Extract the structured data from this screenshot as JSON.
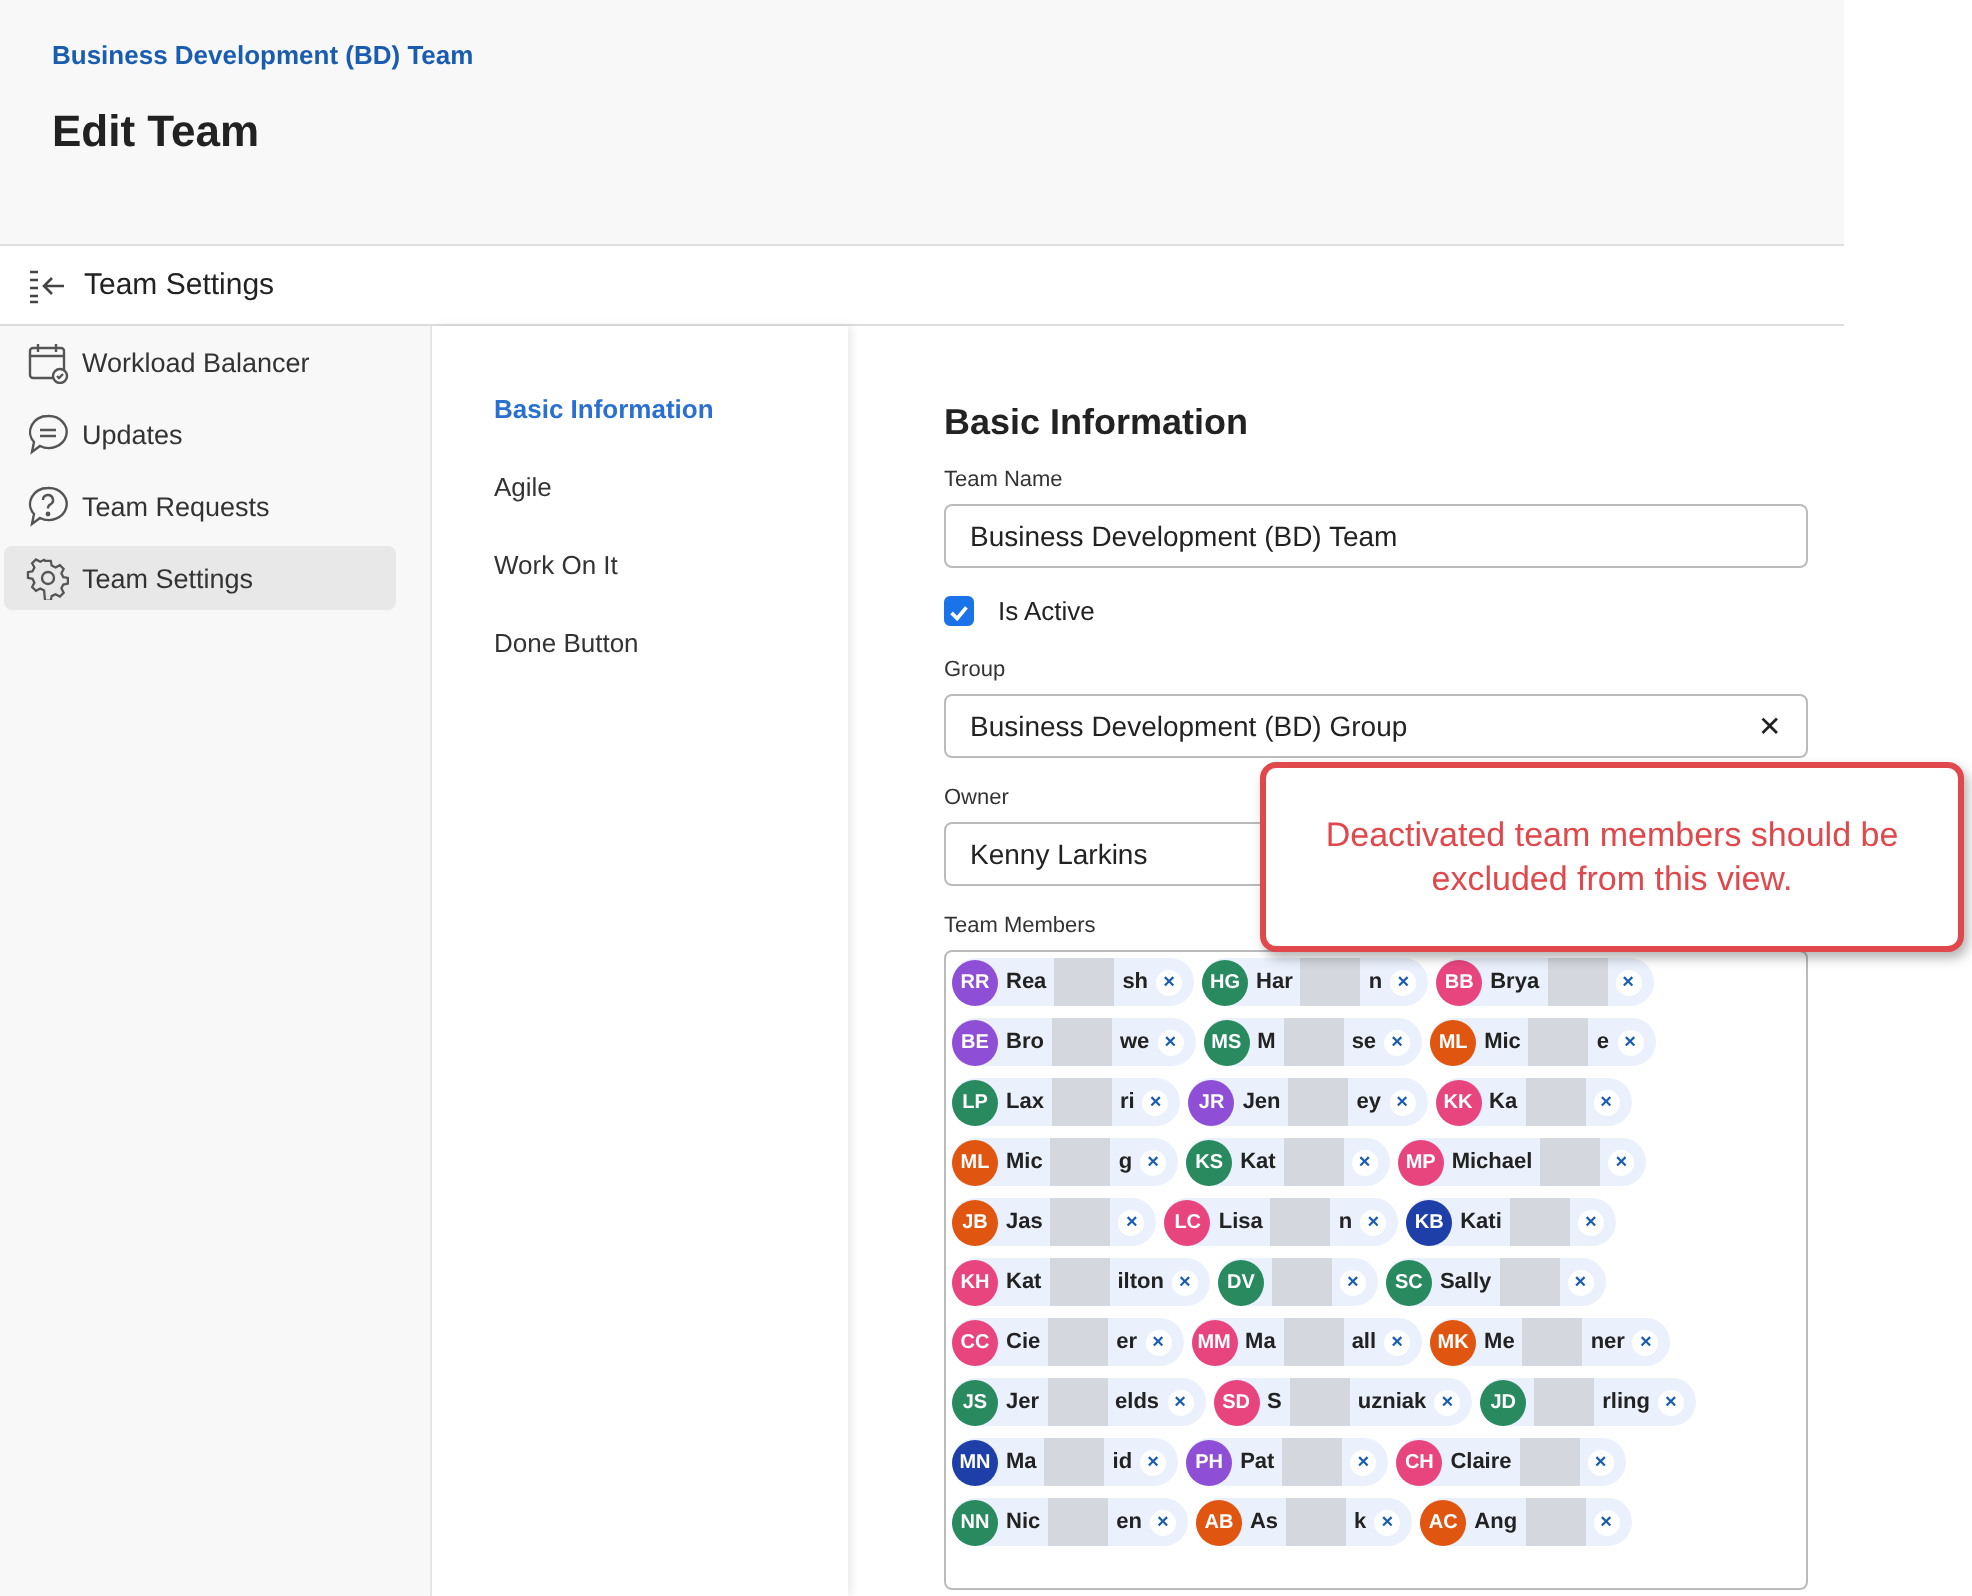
{
  "header": {
    "breadcrumb": "Business Development (BD) Team",
    "title": "Edit Team"
  },
  "settings_bar": {
    "title": "Team Settings"
  },
  "sidebar": {
    "items": [
      {
        "label": "Workload Balancer",
        "selected": false
      },
      {
        "label": "Updates",
        "selected": false
      },
      {
        "label": "Team Requests",
        "selected": false
      },
      {
        "label": "Team Settings",
        "selected": true
      }
    ]
  },
  "section_nav": {
    "items": [
      {
        "label": "Basic Information",
        "selected": true
      },
      {
        "label": "Agile",
        "selected": false
      },
      {
        "label": "Work On It",
        "selected": false
      },
      {
        "label": "Done Button",
        "selected": false
      }
    ]
  },
  "form": {
    "heading": "Basic Information",
    "team_name": {
      "label": "Team Name",
      "value": "Business Development (BD) Team"
    },
    "is_active": {
      "label": "Is Active",
      "checked": true
    },
    "group": {
      "label": "Group",
      "value": "Business Development (BD) Group",
      "clear": "✕"
    },
    "owner": {
      "label": "Owner",
      "value": "Kenny Larkins"
    },
    "team_members": {
      "label": "Team Members",
      "remove": "×",
      "members": [
        {
          "initials": "RR",
          "color": "#8e4fd6",
          "start": "Rea",
          "end": "sh"
        },
        {
          "initials": "HG",
          "color": "#2a8a5f",
          "start": "Har",
          "end": "n"
        },
        {
          "initials": "BB",
          "color": "#e8457e",
          "start": "Brya"
        },
        {
          "initials": "BE",
          "color": "#8e4fd6",
          "start": "Bro",
          "end": "we"
        },
        {
          "initials": "MS",
          "color": "#2a8a5f",
          "start": "M",
          "end": "se"
        },
        {
          "initials": "ML",
          "color": "#e0550f",
          "start": "Mic",
          "end": "e"
        },
        {
          "initials": "LP",
          "color": "#2a8a5f",
          "start": "Lax",
          "end": "ri"
        },
        {
          "initials": "JR",
          "color": "#8e4fd6",
          "start": "Jen",
          "end": "ey"
        },
        {
          "initials": "KK",
          "color": "#e8457e",
          "start": "Ka"
        },
        {
          "initials": "ML",
          "color": "#e0550f",
          "start": "Mic",
          "end": "g"
        },
        {
          "initials": "KS",
          "color": "#2a8a5f",
          "start": "Kat"
        },
        {
          "initials": "MP",
          "color": "#e8457e",
          "start": "Michael"
        },
        {
          "initials": "JB",
          "color": "#e0550f",
          "start": "Jas"
        },
        {
          "initials": "LC",
          "color": "#e8457e",
          "start": "Lisa",
          "end": "n"
        },
        {
          "initials": "KB",
          "color": "#1f3fa8",
          "start": "Kati"
        },
        {
          "initials": "KH",
          "color": "#e8457e",
          "start": "Kat",
          "end": "ilton"
        },
        {
          "initials": "DV",
          "color": "#2a8a5f"
        },
        {
          "initials": "SC",
          "color": "#2a8a5f",
          "start": "Sally"
        },
        {
          "initials": "CC",
          "color": "#e8457e",
          "start": "Cie",
          "end": "er"
        },
        {
          "initials": "MM",
          "color": "#e8457e",
          "start": "Ma",
          "end": "all"
        },
        {
          "initials": "MK",
          "color": "#e0550f",
          "start": "Me",
          "end": "ner"
        },
        {
          "initials": "JS",
          "color": "#2a8a5f",
          "start": "Jer",
          "end": "elds"
        },
        {
          "initials": "SD",
          "color": "#e8457e",
          "start": "S",
          "end": "uzniak"
        },
        {
          "initials": "JD",
          "color": "#2a8a5f",
          "end": "rling"
        },
        {
          "initials": "MN",
          "color": "#1f3fa8",
          "start": "Ma",
          "end": "id"
        },
        {
          "initials": "PH",
          "color": "#8e4fd6",
          "start": "Pat"
        },
        {
          "initials": "CH",
          "color": "#e8457e",
          "start": "Claire"
        },
        {
          "initials": "NN",
          "color": "#2a8a5f",
          "start": "Nic",
          "end": "en"
        },
        {
          "initials": "AB",
          "color": "#e0550f",
          "start": "As",
          "end": "k"
        },
        {
          "initials": "AC",
          "color": "#e0550f",
          "start": "Ang"
        }
      ]
    }
  },
  "callout": {
    "text": "Deactivated team members should be excluded from this view."
  }
}
